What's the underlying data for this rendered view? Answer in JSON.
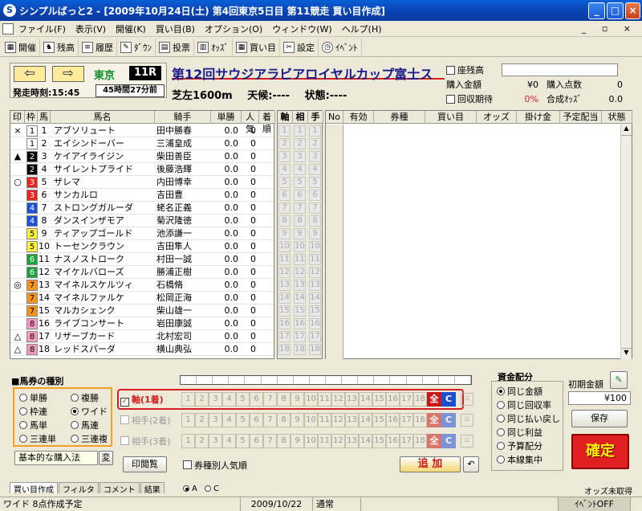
{
  "window": {
    "title": "シンプルばっと2 - [2009年10月24日(土) 第4回東京5日目 第11競走 買い目作成]",
    "icon": "S"
  },
  "menu": [
    "ファイル(F)",
    "表示(V)",
    "開催(K)",
    "買い目(B)",
    "オプション(O)",
    "ウィンドウ(W)",
    "ヘルプ(H)"
  ],
  "toolbar": [
    {
      "label": "開催",
      "icon": "calendar-icon"
    },
    {
      "label": "残高",
      "icon": "horse-icon"
    },
    {
      "label": "履歴",
      "icon": "list-icon"
    },
    {
      "label": "ﾀﾞｳﾝ",
      "icon": "pencil-icon"
    },
    {
      "label": "投票",
      "icon": "ballot-icon"
    },
    {
      "label": "ｵｯｽﾞ",
      "icon": "odds-icon"
    },
    {
      "label": "買い目",
      "icon": "grid-icon"
    },
    {
      "label": "設定",
      "icon": "tools-icon"
    },
    {
      "label": "ｲﾍﾞﾝﾄ",
      "icon": "clock-icon"
    }
  ],
  "race": {
    "venue": "東京",
    "number": "11R",
    "start_time": "発走時刻:15:45",
    "remaining": "45時間27分前",
    "name": "第12回サウジアラビアロイヤルカップ富士ス",
    "course": "芝左1600m",
    "weather_label": "天候:----",
    "condition_label": "状態:----"
  },
  "stats": {
    "zandaka_label": "座残高",
    "zandaka_value": "",
    "amount_label": "購入金額",
    "amount_value": "¥0",
    "points_label": "購入点数",
    "points_value": "0",
    "recovery_label": "回収期待",
    "recovery_value": "0%",
    "odds_label": "合成ｵｯｽﾞ",
    "odds_value": "0.0"
  },
  "horse_headers": [
    "印",
    "枠",
    "馬",
    "馬名",
    "騎手",
    "単勝",
    "人気",
    "着順"
  ],
  "horses": [
    {
      "mark": "×",
      "frame": "1",
      "num": "1",
      "name": "アブソリュート",
      "jockey": "田中勝春",
      "odds": "0.0",
      "pop": "0"
    },
    {
      "mark": "",
      "frame": "1",
      "num": "2",
      "name": "エイシンドーバー",
      "jockey": "三浦皇成",
      "odds": "0.0",
      "pop": "0"
    },
    {
      "mark": "▲",
      "frame": "2",
      "num": "3",
      "name": "ケイアイライジン",
      "jockey": "柴田善臣",
      "odds": "0.0",
      "pop": "0"
    },
    {
      "mark": "",
      "frame": "2",
      "num": "4",
      "name": "サイレントプライド",
      "jockey": "後藤浩輝",
      "odds": "0.0",
      "pop": "0"
    },
    {
      "mark": "○",
      "frame": "3",
      "num": "5",
      "name": "ザレマ",
      "jockey": "内田博幸",
      "odds": "0.0",
      "pop": "0"
    },
    {
      "mark": "",
      "frame": "3",
      "num": "6",
      "name": "サンカルロ",
      "jockey": "吉田豊",
      "odds": "0.0",
      "pop": "0"
    },
    {
      "mark": "",
      "frame": "4",
      "num": "7",
      "name": "ストロングガルーダ",
      "jockey": "蛯名正義",
      "odds": "0.0",
      "pop": "0"
    },
    {
      "mark": "",
      "frame": "4",
      "num": "8",
      "name": "ダンスインザモア",
      "jockey": "菊沢隆徳",
      "odds": "0.0",
      "pop": "0"
    },
    {
      "mark": "",
      "frame": "5",
      "num": "9",
      "name": "ティアップゴールド",
      "jockey": "池添謙一",
      "odds": "0.0",
      "pop": "0"
    },
    {
      "mark": "",
      "frame": "5",
      "num": "10",
      "name": "トーセンクラウン",
      "jockey": "吉田隼人",
      "odds": "0.0",
      "pop": "0"
    },
    {
      "mark": "",
      "frame": "6",
      "num": "11",
      "name": "ナスノストローク",
      "jockey": "村田一誠",
      "odds": "0.0",
      "pop": "0"
    },
    {
      "mark": "",
      "frame": "6",
      "num": "12",
      "name": "マイケルバローズ",
      "jockey": "勝浦正樹",
      "odds": "0.0",
      "pop": "0"
    },
    {
      "mark": "◎",
      "frame": "7",
      "num": "13",
      "name": "マイネルスケルツィ",
      "jockey": "石橋脩",
      "odds": "0.0",
      "pop": "0"
    },
    {
      "mark": "",
      "frame": "7",
      "num": "14",
      "name": "マイネルファルケ",
      "jockey": "松岡正海",
      "odds": "0.0",
      "pop": "0"
    },
    {
      "mark": "",
      "frame": "7",
      "num": "15",
      "name": "マルカシェンク",
      "jockey": "柴山雄一",
      "odds": "0.0",
      "pop": "0"
    },
    {
      "mark": "",
      "frame": "8",
      "num": "16",
      "name": "ライブコンサート",
      "jockey": "岩田康誠",
      "odds": "0.0",
      "pop": "0"
    },
    {
      "mark": "△",
      "frame": "8",
      "num": "17",
      "name": "リザーブカード",
      "jockey": "北村宏司",
      "odds": "0.0",
      "pop": "0"
    },
    {
      "mark": "△",
      "frame": "8",
      "num": "18",
      "name": "レッドスパーダ",
      "jockey": "横山典弘",
      "odds": "0.0",
      "pop": "0"
    }
  ],
  "frame_colors": {
    "1": [
      "#ffffff",
      "#000000"
    ],
    "2": [
      "#000000",
      "#ffffff"
    ],
    "3": [
      "#e8251f",
      "#ffffff"
    ],
    "4": [
      "#1e4fd8",
      "#ffffff"
    ],
    "5": [
      "#fff23a",
      "#000000"
    ],
    "6": [
      "#1aa33a",
      "#ffffff"
    ],
    "7": [
      "#f7941d",
      "#000000"
    ],
    "8": [
      "#f59ac0",
      "#000000"
    ]
  },
  "pick_headers": [
    "軸",
    "相",
    "手"
  ],
  "ticket_headers": [
    "No",
    "有効",
    "券種",
    "買い目",
    "オッズ",
    "掛け金",
    "予定配当",
    "状態"
  ],
  "bet_types": {
    "title": "■馬券の種別",
    "items": [
      "単勝",
      "複勝",
      "枠連",
      "ワイド",
      "馬単",
      "馬連",
      "三連単",
      "三連複"
    ],
    "selected": "ワイド",
    "purchase_method": "基本的な購入法",
    "change_label": "変"
  },
  "pick_rows": [
    {
      "label": "軸(1着)",
      "checked": true
    },
    {
      "label": "相手(2着)",
      "checked": false
    },
    {
      "label": "相手(3着)",
      "checked": false
    }
  ],
  "numbers": [
    "1",
    "2",
    "3",
    "4",
    "5",
    "6",
    "7",
    "8",
    "9",
    "10",
    "11",
    "12",
    "13",
    "14",
    "15",
    "16",
    "17",
    "18"
  ],
  "all_label": "全",
  "clear_label": "C",
  "print_label": "印閲覧",
  "popularity_label": "券種別人気順",
  "add_label": "追 加",
  "undo_icon": "undo-icon",
  "funds": {
    "title": "資金配分",
    "options": [
      "同じ金額",
      "同じ回収率",
      "同じ払い戻し",
      "同じ利益",
      "予算配分",
      "本線集中"
    ],
    "selected": "同じ金額",
    "initial_label": "初期金額",
    "initial_value": "¥100",
    "save_label": "保存",
    "confirm_label": "確定"
  },
  "tabs": [
    "買い目作成",
    "フィルタ",
    "コメント",
    "結果"
  ],
  "ac": {
    "a": "A",
    "c": "C"
  },
  "odds_unsaved": "オッズ未取得",
  "status": {
    "message": "ワイド 8点作成予定",
    "date": "2009/10/22",
    "mode": "通常",
    "event": "ｲﾍﾞﾝﾄOFF"
  }
}
